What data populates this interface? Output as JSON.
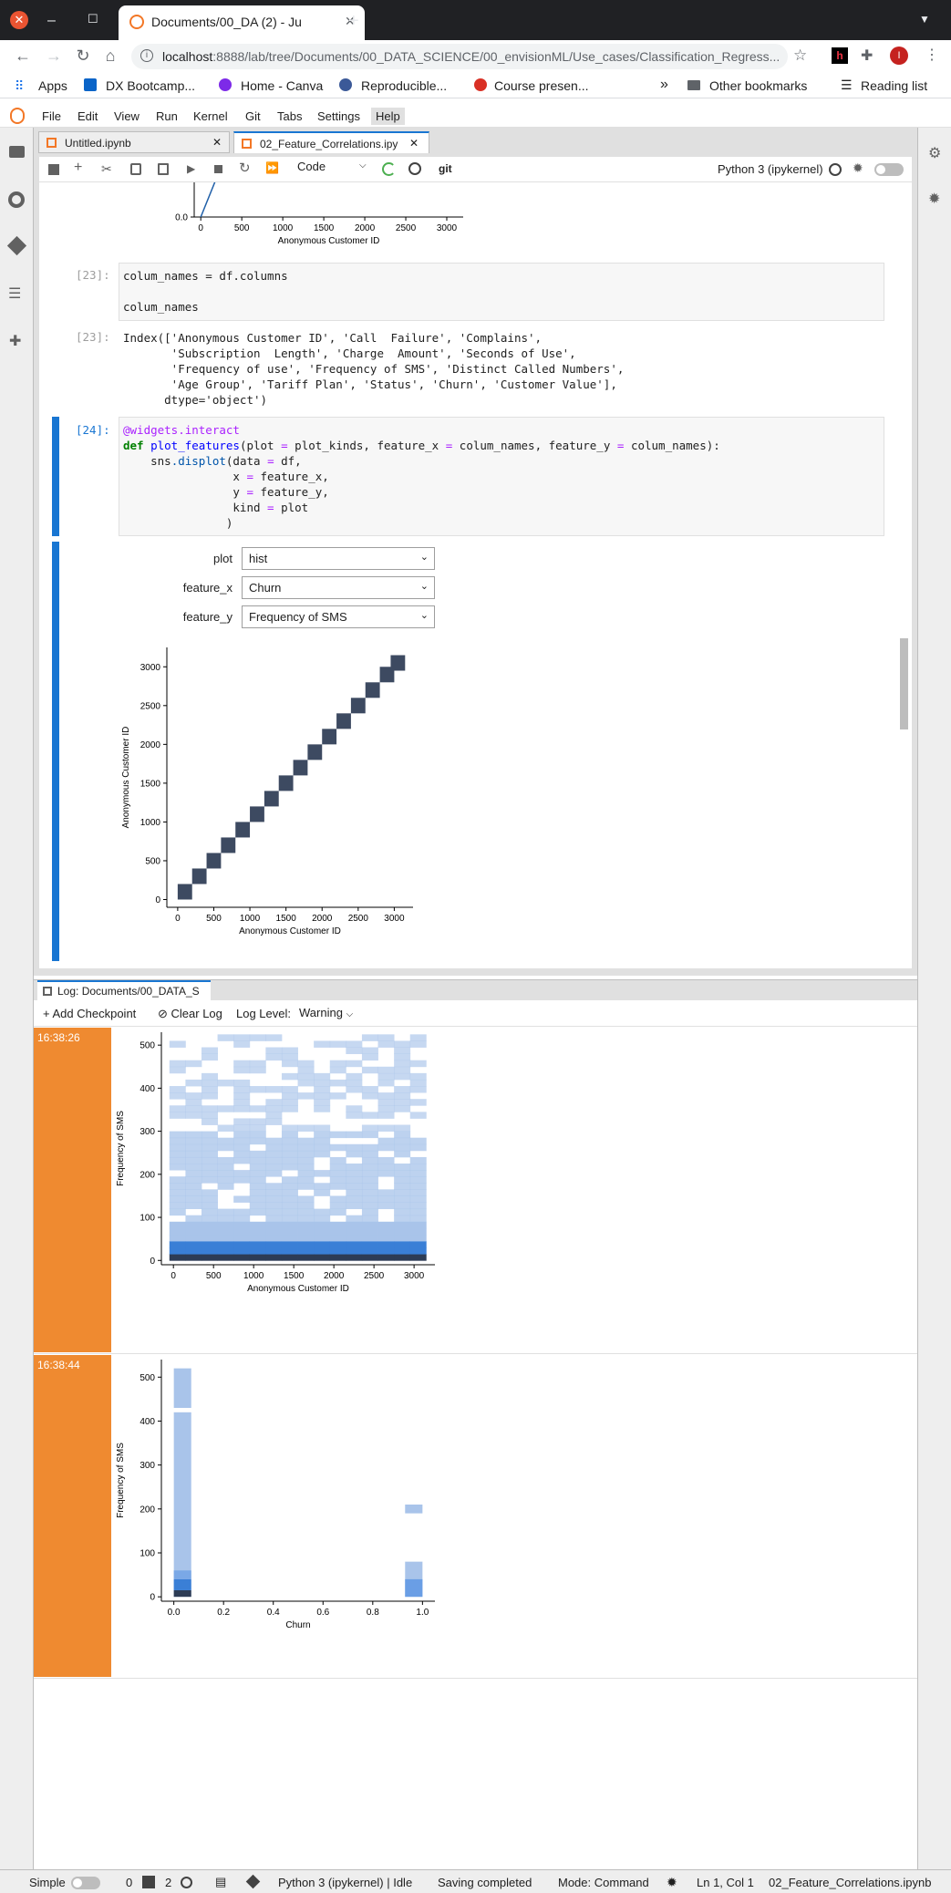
{
  "browser": {
    "tab_title": "Documents/00_DA (2) - Ju",
    "url_host": "localhost",
    "url_rest": ":8888/lab/tree/Documents/00_DATA_SCIENCE/00_envisionML/Use_cases/Classification_Regress...",
    "bookmarks": [
      "Apps",
      "DX Bootcamp...",
      "Home - Canva",
      "Reproducible...",
      "Course presen..."
    ],
    "more_bookmarks": "»",
    "other_bookmarks": "Other bookmarks",
    "reading_list": "Reading list",
    "profile_initial": "I"
  },
  "menu": [
    "File",
    "Edit",
    "View",
    "Run",
    "Kernel",
    "Git",
    "Tabs",
    "Settings",
    "Help"
  ],
  "doc_tabs": [
    {
      "label": "Untitled.ipynb"
    },
    {
      "label": "02_Feature_Correlations.ipy"
    }
  ],
  "toolbar": {
    "cell_type": "Code",
    "git_label": "git",
    "kernel": "Python 3 (ipykernel)"
  },
  "cells": {
    "c23_prompt": "[23]:",
    "c23_code_line1": "colum_names = df.columns",
    "c23_code_line3": "colum_names",
    "c23_out_prompt": "[23]:",
    "c23_output": "Index(['Anonymous Customer ID', 'Call  Failure', 'Complains',\n       'Subscription  Length', 'Charge  Amount', 'Seconds of Use',\n       'Frequency of use', 'Frequency of SMS', 'Distinct Called Numbers',\n       'Age Group', 'Tariff Plan', 'Status', 'Churn', 'Customer Value'],\n      dtype='object')",
    "c24_prompt": "[24]:"
  },
  "widgets": {
    "plot_label": "plot",
    "plot_value": "hist",
    "fx_label": "feature_x",
    "fx_value": "Churn",
    "fy_label": "feature_y",
    "fy_value": "Frequency of SMS"
  },
  "log_panel": {
    "tab_label": "Log: Documents/00_DATA_S",
    "add_checkpoint": "Add Checkpoint",
    "clear_log": "Clear Log",
    "log_level_label": "Log Level:",
    "log_level_value": "Warning",
    "entry1_time": "16:38:26",
    "entry2_time": "16:38:44"
  },
  "status_bar": {
    "mode_label": "Simple",
    "terminals": "0",
    "kernels": "2",
    "kernel_status": "Python 3 (ipykernel) | Idle",
    "saving": "Saving completed",
    "mode": "Mode: Command",
    "position": "Ln 1, Col 1",
    "filename": "02_Feature_Correlations.ipynb"
  },
  "chart_data": [
    {
      "type": "line",
      "partial": true,
      "xlabel": "Anonymous Customer ID",
      "x_ticks": [
        0,
        500,
        1000,
        1500,
        2000,
        2500,
        3000
      ],
      "y_ticks": [
        0.0
      ]
    },
    {
      "type": "heatmap",
      "xlabel": "Anonymous Customer ID",
      "ylabel": "Anonymous Customer ID",
      "x_ticks": [
        0,
        500,
        1000,
        1500,
        2000,
        2500,
        3000
      ],
      "y_ticks": [
        0,
        500,
        1000,
        1500,
        2000,
        2500,
        3000
      ],
      "diagonal_bins": [
        100,
        300,
        500,
        700,
        900,
        1100,
        1300,
        1500,
        1700,
        1900,
        2100,
        2300,
        2500,
        2700,
        2900,
        3050
      ],
      "color": "#3d4a61"
    },
    {
      "type": "heatmap",
      "xlabel": "Anonymous Customer ID",
      "ylabel": "Frequency of SMS",
      "x_ticks": [
        0,
        500,
        1000,
        1500,
        2000,
        2500,
        3000
      ],
      "y_ticks": [
        0,
        100,
        200,
        300,
        400,
        500
      ],
      "ylim": [
        -10,
        530
      ],
      "color": "#a9c4ea"
    },
    {
      "type": "heatmap",
      "xlabel": "Churn",
      "ylabel": "Frequency of SMS",
      "x_ticks": [
        0.0,
        0.2,
        0.4,
        0.6,
        0.8,
        1.0
      ],
      "y_ticks": [
        0,
        100,
        200,
        300,
        400,
        500
      ],
      "ylim": [
        -10,
        540
      ],
      "bars": [
        {
          "x": 0.0,
          "segments": [
            [
              430,
              520
            ],
            [
              0,
              420
            ]
          ]
        },
        {
          "x": 1.0,
          "segments": [
            [
              190,
              210
            ],
            [
              0,
              80
            ]
          ]
        }
      ],
      "color": "#a9c4ea"
    }
  ]
}
